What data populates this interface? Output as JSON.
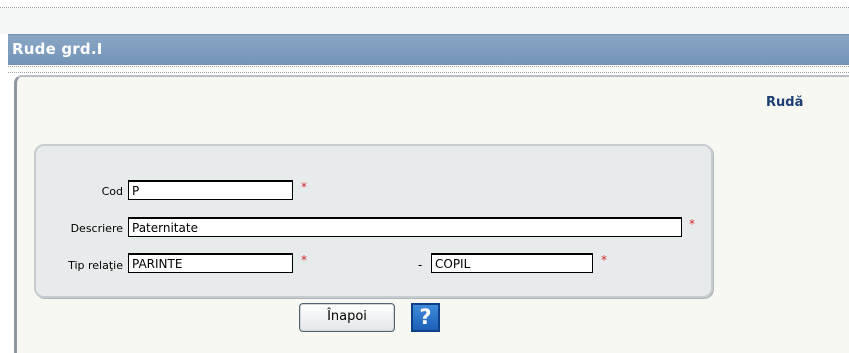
{
  "window": {
    "title": "Rude grd.I"
  },
  "panel": {
    "entity_title": "Rudă"
  },
  "form": {
    "cod": {
      "label": "Cod",
      "value": "P",
      "required_mark": "*"
    },
    "descriere": {
      "label": "Descriere",
      "value": "Paternitate",
      "required_mark": "*"
    },
    "tip_relatie": {
      "label": "Tip relaţie",
      "value_from": "PARINTE",
      "separator": "-",
      "value_to": "COPIL",
      "required_mark": "*"
    }
  },
  "buttons": {
    "back_label": "Înapoi",
    "help_label": "?"
  },
  "colors": {
    "titlebar": "#7394b8",
    "entity_title": "#1b3f73",
    "required_mark": "#d22a2a",
    "help_button": "#1c5fb7"
  }
}
